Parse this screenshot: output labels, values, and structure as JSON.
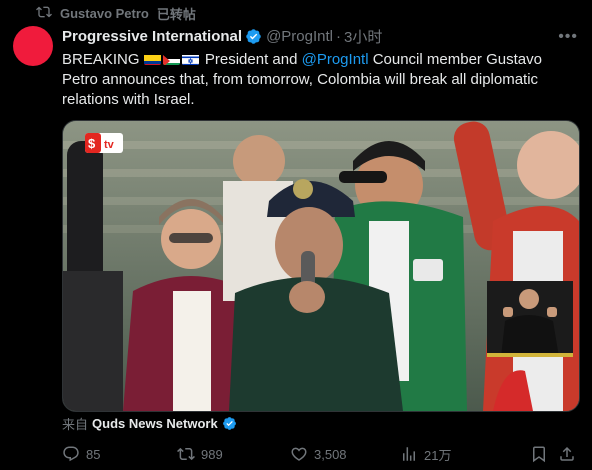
{
  "repost": {
    "user": "Gustavo Petro",
    "label": "已转帖"
  },
  "author": {
    "name": "Progressive International",
    "handle": "@ProgIntl",
    "separator": "·",
    "time": "3小时",
    "avatar_color": "#f01b3c",
    "verified_color": "#1d9bf0"
  },
  "tweet": {
    "prefix": "BREAKING",
    "text_before_mention": " President and ",
    "mention": "@ProgIntl",
    "text_after_mention": " Council member Gustavo Petro announces that, from tomorrow, Colombia will break all diplomatic relations with Israel.",
    "flags": [
      "colombia-flag",
      "palestine-flag",
      "israel-flag"
    ]
  },
  "media": {
    "watermark": "tv"
  },
  "source": {
    "prefix": "来自",
    "name": "Quds News Network"
  },
  "actions": {
    "replies": "85",
    "reposts": "989",
    "likes": "3,508",
    "views": "21万"
  },
  "colors": {
    "background": "#000000",
    "text": "#e7e9ea",
    "muted": "#71767b",
    "accent": "#1d9bf0"
  }
}
